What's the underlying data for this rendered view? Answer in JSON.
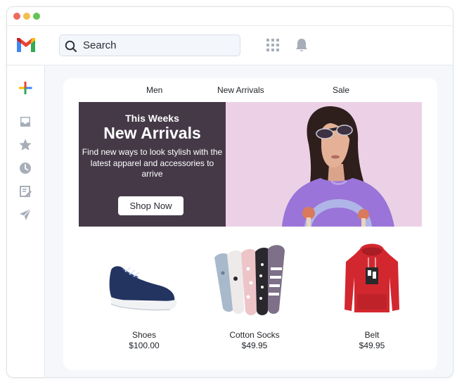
{
  "window": {
    "traffic_lights": [
      "#ec6a5e",
      "#f4bf4f",
      "#61c554"
    ]
  },
  "header": {
    "logo_icon": "gmail-logo-icon",
    "search_placeholder": "Search",
    "apps_icon": "apps-grid-icon",
    "notification_icon": "bell-icon"
  },
  "sidebar": {
    "items": [
      {
        "icon": "compose-plus-icon"
      },
      {
        "icon": "inbox-icon"
      },
      {
        "icon": "star-icon"
      },
      {
        "icon": "clock-icon"
      },
      {
        "icon": "drafts-icon"
      },
      {
        "icon": "send-icon"
      }
    ]
  },
  "shop": {
    "nav": [
      "Men",
      "New Arrivals",
      "Sale"
    ],
    "hero": {
      "subtitle": "This Weeks",
      "title": "New Arrivals",
      "description": "Find new ways to look stylish with the latest apparel and accessories to arrive",
      "button": "Shop Now",
      "panel_color": "#453948",
      "image_bg": "#ecd1e6"
    },
    "products": [
      {
        "name": "Shoes",
        "price": "$100.00"
      },
      {
        "name": "Cotton Socks",
        "price": "$49.95"
      },
      {
        "name": "Belt",
        "price": "$49.95"
      }
    ]
  }
}
